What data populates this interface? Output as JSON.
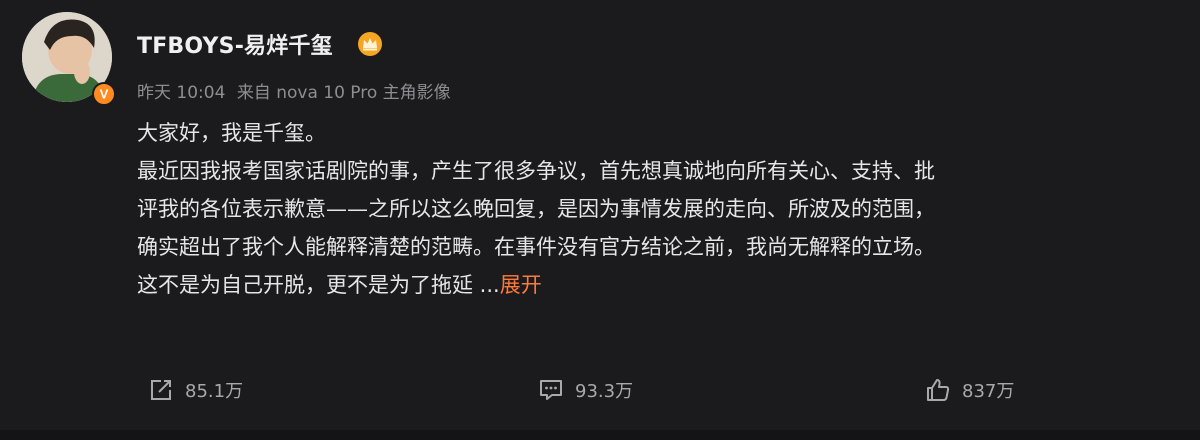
{
  "post": {
    "author": {
      "name": "TFBOYS-易烊千玺",
      "avatar_icon": "user-avatar-photo",
      "verified_icon": "verified-v-badge-icon",
      "member_icon": "crown-icon",
      "verified_color": "#ff8a1f",
      "member_color": "#f5a623"
    },
    "meta": {
      "time": "昨天 10:04",
      "source": "来自 nova 10 Pro 主角影像"
    },
    "body": {
      "lines": [
        "大家好，我是千玺。",
        "最近因我报考国家话剧院的事，产生了很多争议，首先想真诚地向所有关心、支持、批",
        "评我的各位表示歉意——之所以这么晚回复，是因为事情发展的走向、所波及的范围，",
        "确实超出了我个人能解释清楚的范畴。在事件没有官方结论之前，我尚无解释的立场。",
        "这不是为自己开脱，更不是为了拖延 ..."
      ],
      "expand_label": "展开",
      "expand_color": "#ff7a3a"
    },
    "actions": {
      "repost": {
        "icon": "share-icon",
        "count": "85.1万"
      },
      "comment": {
        "icon": "comment-icon",
        "count": "93.3万"
      },
      "like": {
        "icon": "thumbs-up-icon",
        "count": "837万"
      }
    }
  }
}
